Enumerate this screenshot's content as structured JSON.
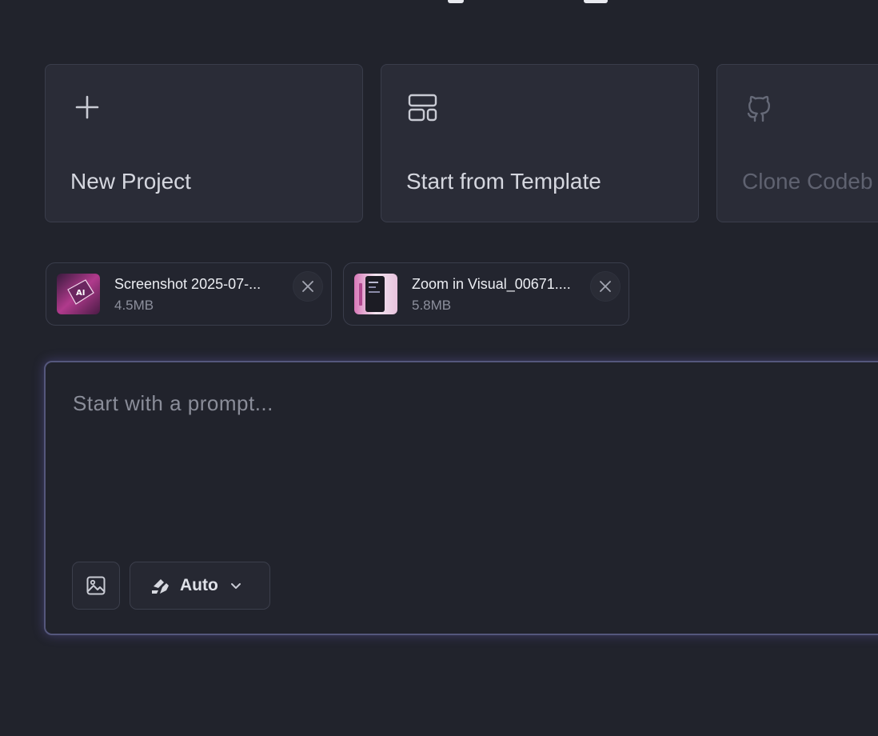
{
  "cards": [
    {
      "label": "New Project",
      "icon": "plus-icon"
    },
    {
      "label": "Start from Template",
      "icon": "template-icon"
    },
    {
      "label": "Clone Codeb",
      "icon": "github-icon"
    }
  ],
  "attachments": [
    {
      "name": "Screenshot 2025-07-...",
      "size": "4.5MB",
      "thumb_icon": "image-thumbnail"
    },
    {
      "name": "Zoom in Visual_00671....",
      "size": "5.8MB",
      "thumb_icon": "image-thumbnail"
    }
  ],
  "prompt": {
    "placeholder": "Start with a prompt...",
    "model_label": "Auto"
  },
  "colors": {
    "background": "#21232c",
    "card": "#2a2c37",
    "accent_glow": "#55577c"
  }
}
